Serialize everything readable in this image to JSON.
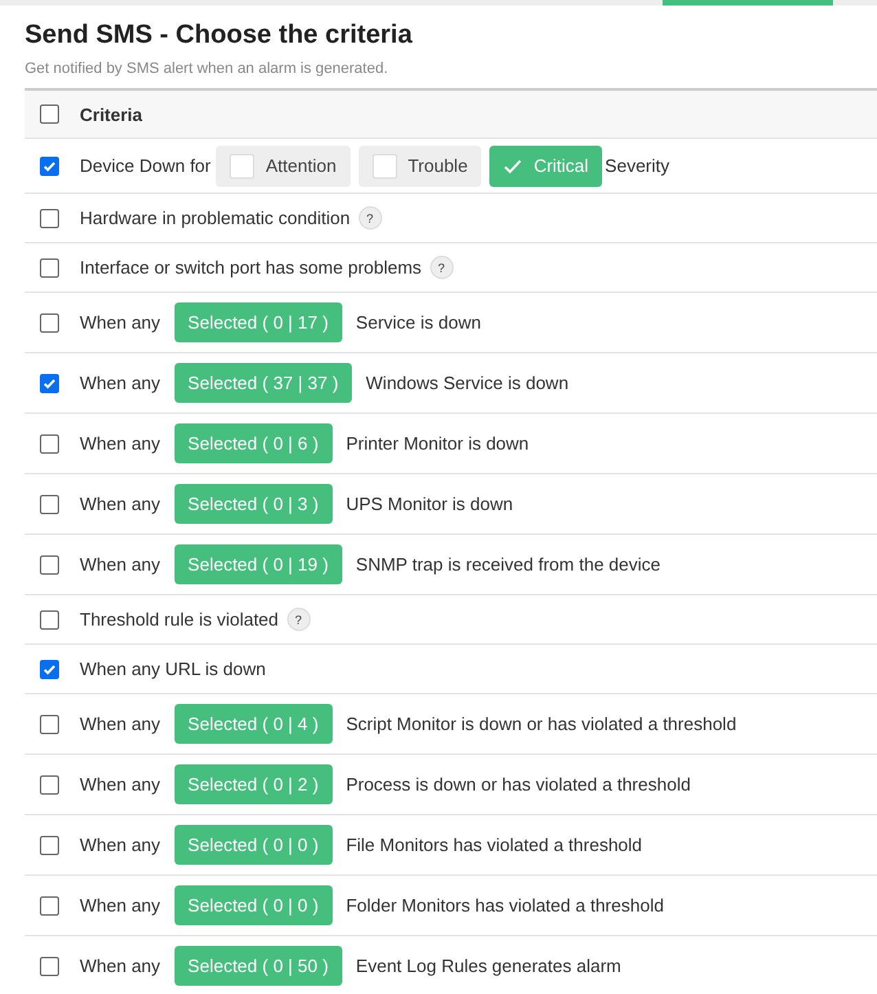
{
  "header": {
    "title": "Send SMS - Choose the criteria",
    "subtitle": "Get notified by SMS alert when an alarm is generated."
  },
  "table": {
    "header": {
      "label": "Criteria",
      "checked": false
    },
    "rows": [
      {
        "kind": "severity",
        "checked": true,
        "prefix": "Device Down for",
        "options": [
          {
            "label": "Attention",
            "checked": false
          },
          {
            "label": "Trouble",
            "checked": false
          },
          {
            "label": "Critical",
            "checked": true
          }
        ],
        "suffix": "Severity"
      },
      {
        "kind": "plain",
        "checked": false,
        "text": "Hardware in problematic condition",
        "help": "?"
      },
      {
        "kind": "plain",
        "checked": false,
        "text": "Interface or switch port has some problems",
        "help": "?"
      },
      {
        "kind": "selector",
        "checked": false,
        "prefix": "When any",
        "button": "Selected ( 0 | 17 )",
        "suffix": "Service is down"
      },
      {
        "kind": "selector",
        "checked": true,
        "prefix": "When any",
        "button": "Selected ( 37 | 37 )",
        "suffix": "Windows Service is down"
      },
      {
        "kind": "selector",
        "checked": false,
        "prefix": "When any",
        "button": "Selected ( 0 | 6 )",
        "suffix": "Printer Monitor is down"
      },
      {
        "kind": "selector",
        "checked": false,
        "prefix": "When any",
        "button": "Selected ( 0 | 3 )",
        "suffix": "UPS Monitor is down"
      },
      {
        "kind": "selector",
        "checked": false,
        "prefix": "When any",
        "button": "Selected ( 0 | 19 )",
        "suffix": "SNMP trap is received from the device"
      },
      {
        "kind": "plain",
        "checked": false,
        "text": "Threshold rule is violated",
        "help": "?"
      },
      {
        "kind": "plain",
        "checked": true,
        "text": "When any URL is down"
      },
      {
        "kind": "selector",
        "checked": false,
        "prefix": "When any",
        "button": "Selected ( 0 | 4 )",
        "suffix": "Script Monitor is down or has violated a threshold"
      },
      {
        "kind": "selector",
        "checked": false,
        "prefix": "When any",
        "button": "Selected ( 0 | 2 )",
        "suffix": "Process is down or has violated a threshold"
      },
      {
        "kind": "selector",
        "checked": false,
        "prefix": "When any",
        "button": "Selected ( 0 | 0 )",
        "suffix": "File Monitors has violated a threshold"
      },
      {
        "kind": "selector",
        "checked": false,
        "prefix": "When any",
        "button": "Selected ( 0 | 0 )",
        "suffix": "Folder Monitors has violated a threshold"
      },
      {
        "kind": "selector",
        "checked": false,
        "prefix": "When any",
        "button": "Selected ( 0 | 50 )",
        "suffix": "Event Log Rules generates alarm"
      }
    ]
  }
}
